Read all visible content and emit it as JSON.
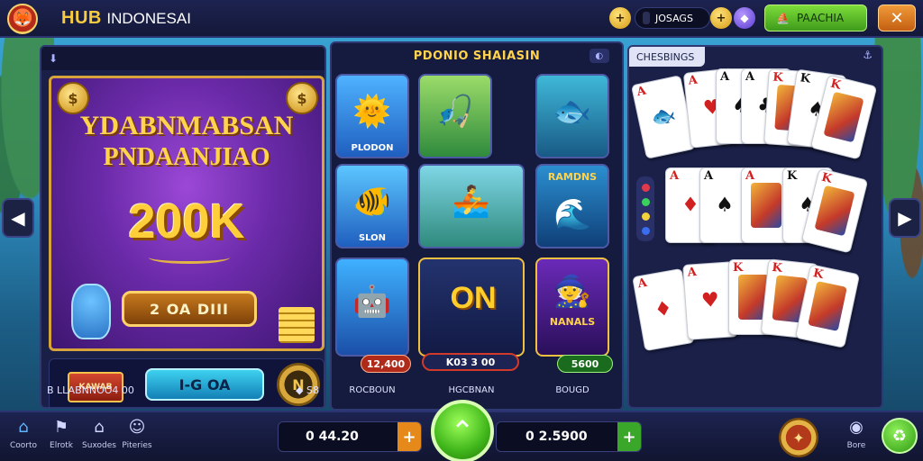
{
  "header": {
    "brand_bold": "HUB",
    "brand_light": "INDONESAI",
    "balance": "JOSAGS",
    "action_label": "PAACHIA",
    "colors": {
      "accent_gold": "#f7cb3f",
      "panel": "#1a1f47",
      "green": "#4fb51e"
    }
  },
  "promo": {
    "title_line1": "YDABNMABSAN",
    "title_line2": "PNDAANJIAO",
    "amount": "200K",
    "cta": "2 OA DIII",
    "strip_badge": "KAWAB",
    "strip_button": "I-G OA",
    "footer_left": "B LLABNNOO4 00",
    "footer_right": "S8"
  },
  "slots": {
    "title": "PDONIO SHAIASIN",
    "tiles": [
      {
        "caption": "PLODON",
        "icon": "sun-face-icon"
      },
      {
        "caption": "",
        "icon": "fishing-rod-fish-icon"
      },
      {
        "caption": "",
        "icon": "fish-icon"
      },
      {
        "caption": "SLON",
        "icon": "fish-icon"
      },
      {
        "caption": "",
        "icon": "boat-fisherman-icon"
      },
      {
        "caption": "RAMDNS",
        "icon": "wave-icon"
      }
    ],
    "big_tiles": [
      {
        "bar": "12,400",
        "footer": "ROCBOUN",
        "icon": "mascot-icon"
      },
      {
        "label": "ON",
        "bar": "K03 3 00",
        "footer": "HGCBNAN",
        "icon": "on-sign-icon"
      },
      {
        "caption": "NANALS",
        "bar": "5600",
        "footer": "BOUGD",
        "icon": "portrait-icon"
      }
    ]
  },
  "cards": {
    "title": "CHESBINGS"
  },
  "footer": {
    "nav": [
      {
        "label": "Coorto",
        "icon": "home-icon"
      },
      {
        "label": "Elrotk",
        "icon": "bookmark-icon"
      },
      {
        "label": "Suxodes",
        "icon": "house-icon"
      },
      {
        "label": "Piteries",
        "icon": "user-icon"
      }
    ],
    "counter_left": "0 44.20",
    "counter_right": "0 2.5900",
    "profile_label": "Bore"
  }
}
